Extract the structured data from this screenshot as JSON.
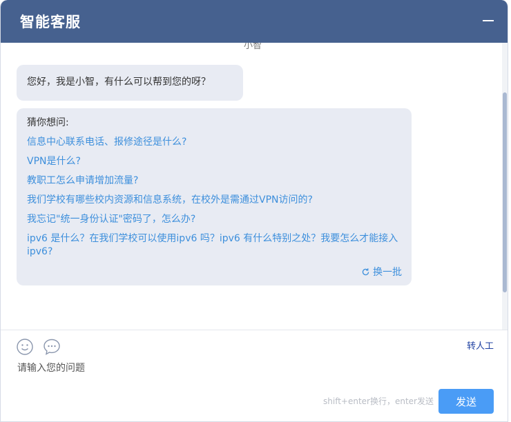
{
  "header": {
    "title": "智能客服"
  },
  "chat": {
    "sender": "小智",
    "greeting": "您好，我是小智，有什么可以帮到您的呀？",
    "suggest_title": "猜你想问:",
    "questions": [
      "信息中心联系电话、报修途径是什么?",
      "VPN是什么?",
      "教职工怎么申请增加流量?",
      "我们学校有哪些校内资源和信息系统，在校外是需通过VPN访问的?",
      "我忘记\"统一身份认证\"密码了，怎么办?",
      "ipv6 是什么？在我们学校可以使用ipv6 吗？ipv6 有什么特别之处？我要怎么才能接入ipv6?"
    ],
    "refresh_label": "换一批"
  },
  "input": {
    "transfer_label": "转人工",
    "placeholder": "请输入您的问题",
    "hint": "shift+enter换行，enter发送",
    "send_label": "发送"
  },
  "colors": {
    "header": "#46618f",
    "link": "#3d8fdc",
    "send": "#4a9cf6",
    "bubble": "#e8ebf3"
  },
  "icons": [
    "minimize-icon",
    "refresh-icon",
    "emoji-icon",
    "message-icon"
  ]
}
